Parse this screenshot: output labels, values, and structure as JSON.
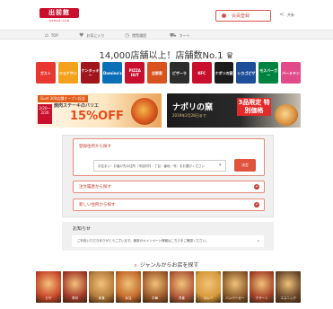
{
  "header": {
    "logo_text": "出前館",
    "logo_sub": "DEMAE-CAN",
    "login_label": "会員登録",
    "share_label": "共有"
  },
  "nav": {
    "items": [
      {
        "label": "TOP",
        "icon": "home-icon"
      },
      {
        "label": "お気に入り",
        "icon": "heart-icon"
      },
      {
        "label": "閲覧履歴",
        "icon": "history-icon"
      },
      {
        "label": "カート",
        "icon": "cart-icon"
      }
    ]
  },
  "hero": {
    "title": "14,000店舗以上！店舗数No.1"
  },
  "brands": [
    {
      "label": "ガスト",
      "color": "#e8382f"
    },
    {
      "label": "ジョナサン",
      "color": "#f4a21d"
    },
    {
      "label": "ケンタッキー",
      "color": "#a3151d"
    },
    {
      "label": "Domino's",
      "color": "#0b6fb8"
    },
    {
      "label": "PIZZA HUT",
      "color": "#c8102e"
    },
    {
      "label": "吉野家",
      "color": "#d9531e"
    },
    {
      "label": "ピザーラ",
      "color": "#2d2d2d"
    },
    {
      "label": "KFC",
      "color": "#c8102e"
    },
    {
      "label": "ナポリの窯",
      "color": "#1c1c1c"
    },
    {
      "label": "シカゴピザ",
      "color": "#1d4e9a"
    },
    {
      "label": "モスバーガー",
      "color": "#00833f"
    },
    {
      "label": "バーミヤン",
      "color": "#e24b8a"
    }
  ],
  "banners": {
    "left": {
      "tag": "Gust 300店舗オープン記念",
      "line1": "焼肉ステーキのバリエ",
      "big": "15%OFF",
      "date": "2/20〜2/26"
    },
    "right": {
      "brand": "ナポリの窯",
      "sub": "2019年2月28日まで",
      "limited": "3品限定 特別価格"
    }
  },
  "search": {
    "address_label": "登録住所から探す",
    "address_value": "お住まい・お届け先の住所（市区町村・丁目・番地・号）をお選びください",
    "go_label": "決定",
    "history_label": "注文履歴から探す",
    "other_label": "新しい住所から探す"
  },
  "news": {
    "title": "お知らせ",
    "item_text": "ご利用いただきありがとうございます。最新のキャンペーン情報はこちらをご確認ください。"
  },
  "genre": {
    "title": "ジャンルからお店を探す",
    "items": [
      {
        "label": "ピザ",
        "color": "#c9472a"
      },
      {
        "label": "寿司",
        "color": "#a33a2a"
      },
      {
        "label": "和食",
        "color": "#b47a3a"
      },
      {
        "label": "弁当",
        "color": "#c46a2c"
      },
      {
        "label": "中華",
        "color": "#9e5a2a"
      },
      {
        "label": "洋食",
        "color": "#b05a3a"
      },
      {
        "label": "カレー",
        "color": "#d79a3a"
      },
      {
        "label": "ハンバーガー",
        "color": "#8a5a2a"
      },
      {
        "label": "デザート",
        "color": "#a5452a"
      },
      {
        "label": "エスニック",
        "color": "#6a4a2a"
      }
    ]
  }
}
